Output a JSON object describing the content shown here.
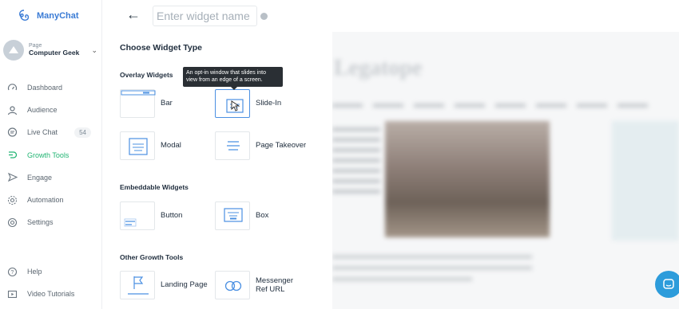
{
  "app": {
    "name": "ManyChat",
    "brand_color": "#3a7bd5",
    "accent_active": "#22b573"
  },
  "page": {
    "caption": "Page",
    "name": "Computer Geek"
  },
  "sidebar": {
    "items": [
      {
        "label": "Dashboard",
        "icon": "dashboard-icon"
      },
      {
        "label": "Audience",
        "icon": "user-icon"
      },
      {
        "label": "Live Chat",
        "icon": "chat-icon",
        "badge": "54"
      },
      {
        "label": "Growth Tools",
        "icon": "growth-tools-icon",
        "active": true
      },
      {
        "label": "Engage",
        "icon": "send-icon"
      },
      {
        "label": "Automation",
        "icon": "automation-icon"
      },
      {
        "label": "Settings",
        "icon": "gear-icon"
      }
    ],
    "bottom": [
      {
        "label": "Help",
        "icon": "help-icon"
      },
      {
        "label": "Video Tutorials",
        "icon": "video-icon"
      }
    ]
  },
  "header": {
    "back_icon": "arrow-left-icon",
    "widget_name_placeholder": "Enter widget name"
  },
  "chooser": {
    "title": "Choose Widget Type",
    "sections": {
      "overlay": "Overlay Widgets",
      "embeddable": "Embeddable Widgets",
      "other": "Other Growth Tools"
    },
    "options": {
      "bar": "Bar",
      "slide_in": "Slide-In",
      "modal": "Modal",
      "page_takeover": "Page Takeover",
      "button": "Button",
      "box": "Box",
      "landing_page": "Landing Page",
      "messenger_ref_url_line1": "Messenger",
      "messenger_ref_url_line2": "Ref URL"
    },
    "tooltip": {
      "line1": "An opt-in window that slides into",
      "line2": "view from an edge of a screen."
    }
  }
}
